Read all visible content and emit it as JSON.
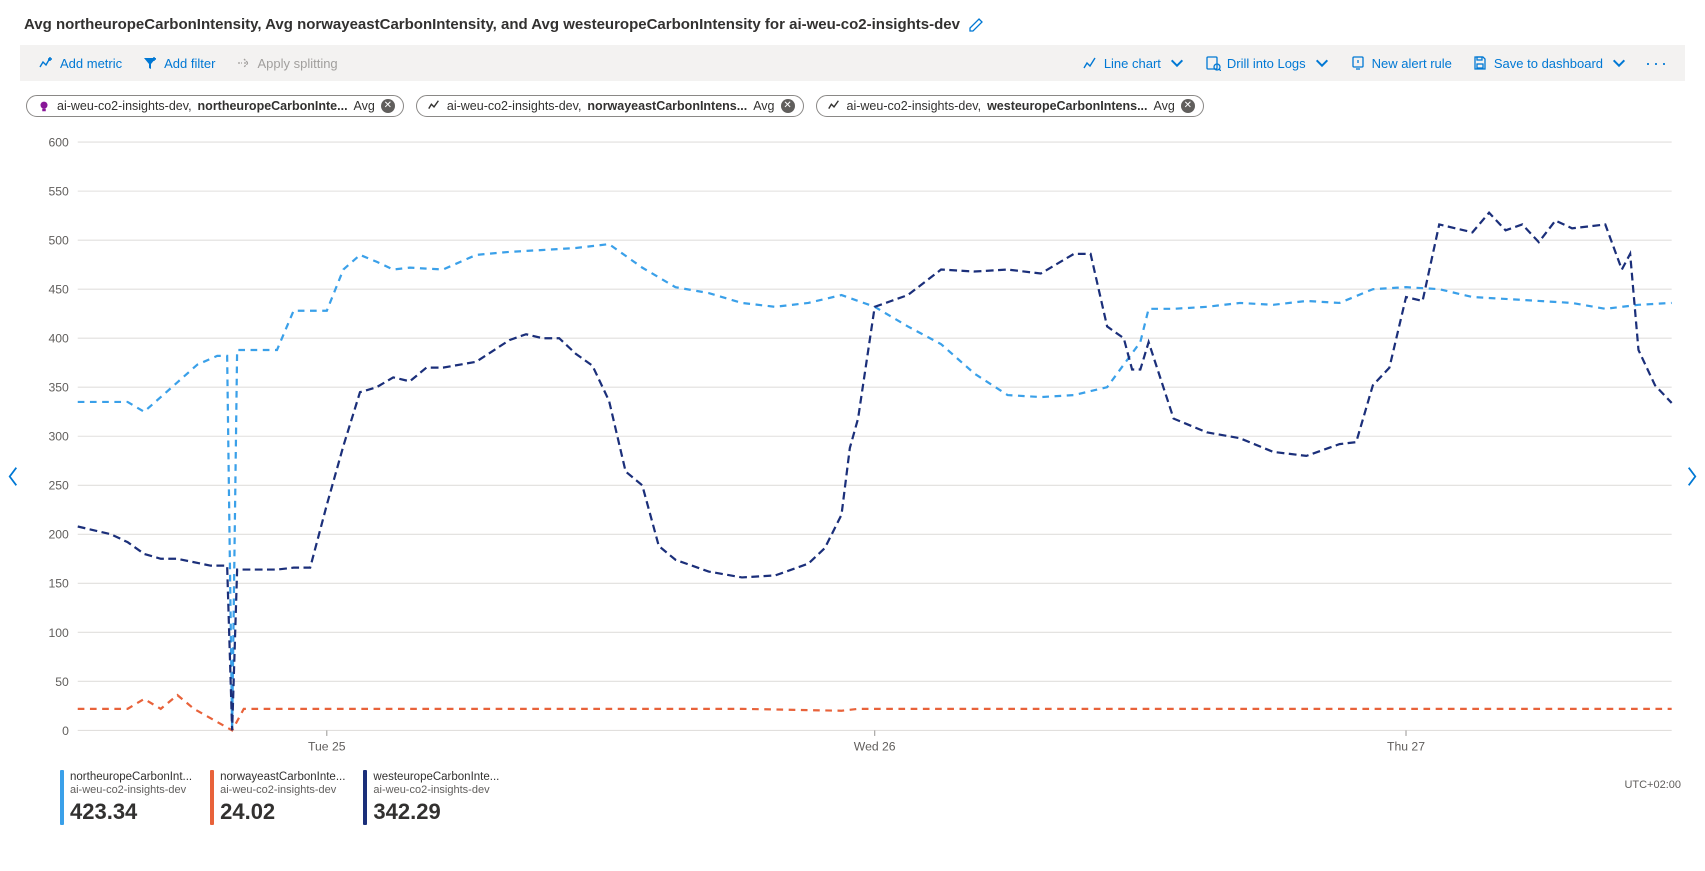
{
  "title": "Avg northeuropeCarbonIntensity, Avg norwayeastCarbonIntensity, and Avg westeuropeCarbonIntensity for ai-weu-co2-insights-dev",
  "toolbar": {
    "add_metric": "Add metric",
    "add_filter": "Add filter",
    "apply_splitting": "Apply splitting",
    "line_chart": "Line chart",
    "drill_logs": "Drill into Logs",
    "new_alert": "New alert rule",
    "save_dashboard": "Save to dashboard"
  },
  "pills": [
    {
      "resource": "ai-weu-co2-insights-dev,",
      "metric": "northeuropeCarbonInte...",
      "agg": "Avg",
      "icon": "lightbulb",
      "iconColor": "#881798"
    },
    {
      "resource": "ai-weu-co2-insights-dev,",
      "metric": "norwayeastCarbonIntens...",
      "agg": "Avg",
      "icon": "line",
      "iconColor": "#323130"
    },
    {
      "resource": "ai-weu-co2-insights-dev,",
      "metric": "westeuropeCarbonIntens...",
      "agg": "Avg",
      "icon": "line",
      "iconColor": "#323130"
    }
  ],
  "legend": [
    {
      "metric": "northeuropeCarbonInt...",
      "sub": "ai-weu-co2-insights-dev",
      "value": "423.34",
      "color": "#3aa0e9"
    },
    {
      "metric": "norwayeastCarbonInte...",
      "sub": "ai-weu-co2-insights-dev",
      "value": "24.02",
      "color": "#e8623a"
    },
    {
      "metric": "westeuropeCarbonInte...",
      "sub": "ai-weu-co2-insights-dev",
      "value": "342.29",
      "color": "#1b2f7a"
    }
  ],
  "timezone": "UTC+02:00",
  "chart_data": {
    "type": "line",
    "title": "",
    "xlabel": "",
    "ylabel": "",
    "ylim": [
      0,
      600
    ],
    "y_ticks": [
      0,
      50,
      100,
      150,
      200,
      250,
      300,
      350,
      400,
      450,
      500,
      550,
      600
    ],
    "x_ticks": [
      "Tue 25",
      "Wed 26",
      "Thu 27"
    ],
    "x_range_hours": 96,
    "series": [
      {
        "name": "northeuropeCarbonIntensity",
        "color": "#3aa0e9",
        "dash": "6 5",
        "values": [
          [
            0,
            335
          ],
          [
            2,
            335
          ],
          [
            3,
            335
          ],
          [
            4,
            325
          ],
          [
            5,
            340
          ],
          [
            6,
            355
          ],
          [
            7.2,
            373
          ],
          [
            8.4,
            382
          ],
          [
            9,
            382
          ],
          [
            9.3,
            0
          ],
          [
            9.6,
            388
          ],
          [
            10,
            388
          ],
          [
            12,
            388
          ],
          [
            13,
            428
          ],
          [
            15,
            428
          ],
          [
            16,
            470
          ],
          [
            17,
            485
          ],
          [
            18,
            478
          ],
          [
            19,
            470
          ],
          [
            20,
            472
          ],
          [
            22,
            470
          ],
          [
            24,
            485
          ],
          [
            26,
            488
          ],
          [
            28,
            490
          ],
          [
            30,
            492
          ],
          [
            32,
            496
          ],
          [
            34,
            472
          ],
          [
            36,
            452
          ],
          [
            38,
            446
          ],
          [
            40,
            436
          ],
          [
            42,
            432
          ],
          [
            44,
            436
          ],
          [
            46,
            444
          ],
          [
            48,
            432
          ],
          [
            50,
            412
          ],
          [
            52,
            394
          ],
          [
            54,
            364
          ],
          [
            56,
            342
          ],
          [
            58,
            340
          ],
          [
            60,
            342
          ],
          [
            62,
            350
          ],
          [
            64,
            396
          ],
          [
            64.5,
            430
          ],
          [
            66,
            430
          ],
          [
            68,
            432
          ],
          [
            70,
            436
          ],
          [
            72,
            434
          ],
          [
            74,
            438
          ],
          [
            76,
            436
          ],
          [
            78,
            450
          ],
          [
            80,
            452
          ],
          [
            82,
            450
          ],
          [
            84,
            442
          ],
          [
            86,
            440
          ],
          [
            88,
            438
          ],
          [
            90,
            436
          ],
          [
            92,
            430
          ],
          [
            94,
            434
          ],
          [
            96,
            436
          ]
        ]
      },
      {
        "name": "norwayeastCarbonIntensity",
        "color": "#e8623a",
        "dash": "6 5",
        "values": [
          [
            0,
            22
          ],
          [
            3,
            22
          ],
          [
            4,
            32
          ],
          [
            5,
            22
          ],
          [
            6,
            36
          ],
          [
            7,
            22
          ],
          [
            9.3,
            0
          ],
          [
            10,
            22
          ],
          [
            20,
            22
          ],
          [
            30,
            22
          ],
          [
            40,
            22
          ],
          [
            46,
            20
          ],
          [
            47,
            22
          ],
          [
            50,
            22
          ],
          [
            60,
            22
          ],
          [
            70,
            22
          ],
          [
            80,
            22
          ],
          [
            90,
            22
          ],
          [
            96,
            22
          ]
        ]
      },
      {
        "name": "westeuropeCarbonIntensity",
        "color": "#1b2f7a",
        "dash": "7 4",
        "values": [
          [
            0,
            208
          ],
          [
            2,
            200
          ],
          [
            3,
            192
          ],
          [
            4,
            180
          ],
          [
            5,
            175
          ],
          [
            6,
            175
          ],
          [
            8,
            168
          ],
          [
            9,
            168
          ],
          [
            9.3,
            0
          ],
          [
            9.6,
            164
          ],
          [
            12,
            164
          ],
          [
            13,
            166
          ],
          [
            14,
            166
          ],
          [
            15,
            230
          ],
          [
            16,
            290
          ],
          [
            17,
            345
          ],
          [
            18,
            350
          ],
          [
            19,
            360
          ],
          [
            20,
            356
          ],
          [
            21,
            370
          ],
          [
            22,
            370
          ],
          [
            24,
            376
          ],
          [
            26,
            398
          ],
          [
            27,
            404
          ],
          [
            28,
            400
          ],
          [
            29,
            400
          ],
          [
            30,
            384
          ],
          [
            31,
            372
          ],
          [
            32,
            336
          ],
          [
            33,
            264
          ],
          [
            34,
            250
          ],
          [
            35,
            188
          ],
          [
            36,
            174
          ],
          [
            38,
            162
          ],
          [
            40,
            156
          ],
          [
            42,
            158
          ],
          [
            44,
            170
          ],
          [
            45,
            186
          ],
          [
            46,
            220
          ],
          [
            46.5,
            288
          ],
          [
            47,
            318
          ],
          [
            48,
            432
          ],
          [
            50,
            444
          ],
          [
            52,
            470
          ],
          [
            54,
            468
          ],
          [
            56,
            470
          ],
          [
            58,
            466
          ],
          [
            60,
            486
          ],
          [
            61,
            486
          ],
          [
            62,
            412
          ],
          [
            63,
            400
          ],
          [
            63.5,
            368
          ],
          [
            64,
            368
          ],
          [
            64.5,
            396
          ],
          [
            66,
            318
          ],
          [
            68,
            304
          ],
          [
            70,
            298
          ],
          [
            72,
            284
          ],
          [
            74,
            280
          ],
          [
            76,
            292
          ],
          [
            77,
            294
          ],
          [
            78,
            352
          ],
          [
            79,
            370
          ],
          [
            80,
            442
          ],
          [
            81,
            438
          ],
          [
            82,
            516
          ],
          [
            84,
            508
          ],
          [
            85,
            528
          ],
          [
            86,
            510
          ],
          [
            87,
            516
          ],
          [
            88,
            498
          ],
          [
            89,
            520
          ],
          [
            90,
            512
          ],
          [
            92,
            516
          ],
          [
            93,
            470
          ],
          [
            93.5,
            486
          ],
          [
            94,
            388
          ],
          [
            95,
            352
          ],
          [
            96,
            334
          ]
        ]
      }
    ]
  }
}
